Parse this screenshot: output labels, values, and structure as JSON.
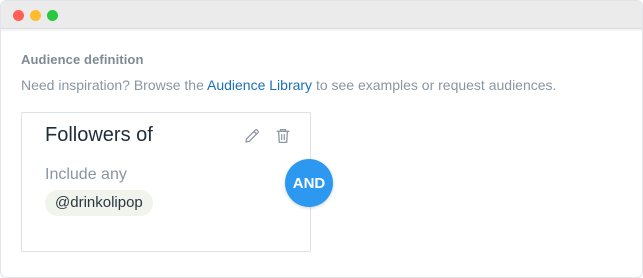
{
  "window": {
    "controls": [
      "close",
      "minimize",
      "zoom"
    ]
  },
  "audience": {
    "section_title": "Audience definition",
    "helper": {
      "before": "Need inspiration? Browse the ",
      "link": "Audience Library",
      "after": " to see examples or request audiences."
    },
    "card": {
      "title": "Followers of",
      "qualifier": "Include any",
      "chips": [
        "@drinkolipop"
      ],
      "edit_icon": "pencil-icon",
      "delete_icon": "trash-icon"
    },
    "operator": "AND"
  },
  "colors": {
    "link": "#1b6fba",
    "operator_bg": "#2d98f0",
    "chip_bg": "#f1f3ed"
  }
}
